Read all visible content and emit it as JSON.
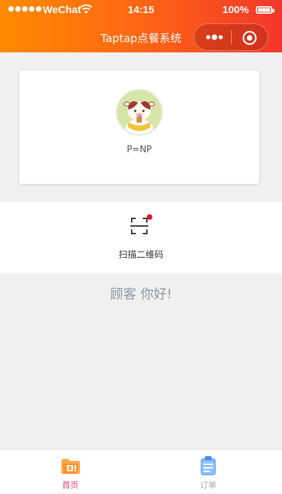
{
  "status_bar": {
    "carrier": "WeChat",
    "time": "14:15",
    "battery": "100%"
  },
  "nav": {
    "title": "Taptap点餐系统"
  },
  "profile": {
    "nickname": "P=NP"
  },
  "scan": {
    "label": "扫描二维码"
  },
  "greeting": "顾客 你好!",
  "tabbar": {
    "home_label": "首页",
    "orders_label": "订单"
  },
  "colors": {
    "header_gradient_start": "#ff8a00",
    "header_gradient_end": "#f3362a",
    "tab_active": "#e54b7a",
    "tab_inactive": "#a6a6a6",
    "badge": "#e0142a",
    "greeting": "#8a98a3"
  }
}
